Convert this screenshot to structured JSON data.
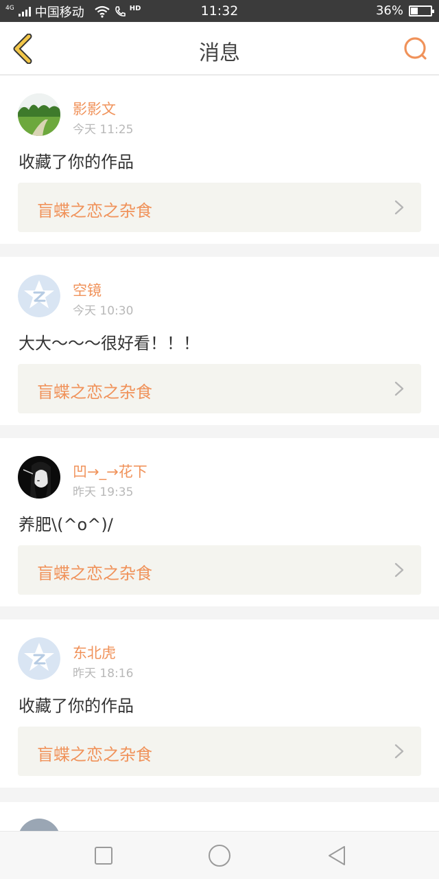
{
  "status_bar": {
    "network": "4G",
    "carrier": "中国移动",
    "time": "11:32",
    "hd": "HD",
    "battery_percent": "36%",
    "battery_level": 0.36
  },
  "header": {
    "title": "消息",
    "back_icon": "chevron-left-icon",
    "search_icon": "search-icon"
  },
  "colors": {
    "accent": "#f0925a",
    "back_icon": "#f3c74a",
    "card_bg": "#ffffff",
    "work_bg": "#f4f4ef",
    "page_bg": "#f4f4f4"
  },
  "messages": [
    {
      "name": "影影文",
      "time": "今天 11:25",
      "text": "收藏了你的作品",
      "work_title": "盲蝶之恋之杂食",
      "avatar": "landscape-avatar"
    },
    {
      "name": "空镜",
      "time": "今天 10:30",
      "text": "大大～～～很好看！！！",
      "work_title": "盲蝶之恋之杂食",
      "avatar": "default-qq-avatar"
    },
    {
      "name": "凹→_→花下",
      "time": "昨天 19:35",
      "text": "养肥\\(^o^)/",
      "work_title": "盲蝶之恋之杂食",
      "avatar": "dark-portrait-avatar"
    },
    {
      "name": "东北虎",
      "time": "昨天 18:16",
      "text": "收藏了你的作品",
      "work_title": "盲蝶之恋之杂食",
      "avatar": "default-qq-avatar"
    }
  ],
  "nav_bar": {
    "buttons": [
      "square-icon",
      "circle-icon",
      "triangle-back-icon"
    ]
  }
}
